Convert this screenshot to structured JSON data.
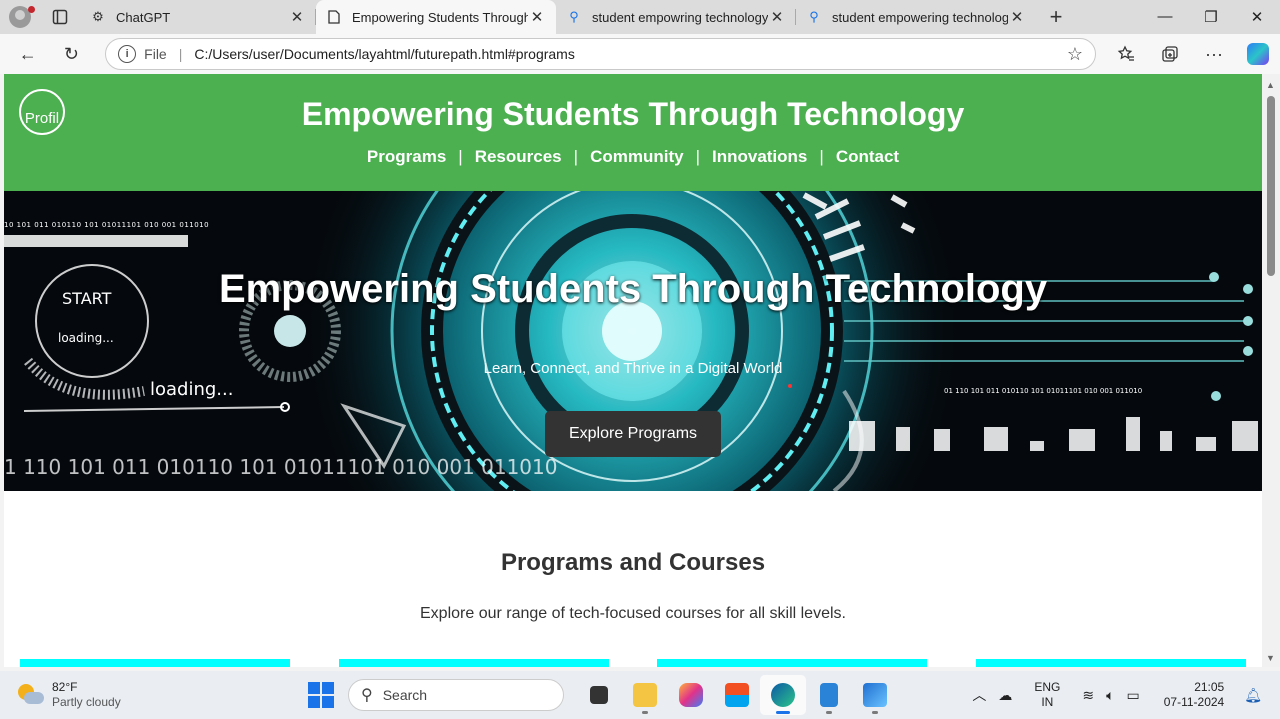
{
  "browser": {
    "tabs": [
      {
        "title": "ChatGPT",
        "icon": "chatgpt-icon",
        "active": false
      },
      {
        "title": "Empowering Students Through Te",
        "icon": "page-icon",
        "active": true
      },
      {
        "title": "student empowring technology s",
        "icon": "search-icon",
        "active": false
      },
      {
        "title": "student empowering technology te",
        "icon": "search-icon",
        "active": false
      }
    ],
    "file_label": "File",
    "url": "C:/Users/user/Documents/layahtml/futurepath.html#programs"
  },
  "site": {
    "logo_alt": "Profil",
    "title": "Empowering Students Through Technology",
    "nav": [
      "Programs",
      "Resources",
      "Community",
      "Innovations",
      "Contact"
    ],
    "hero": {
      "title": "Empowering Students Through Technology",
      "subtitle": "Learn, Connect, and Thrive in a Digital World",
      "button": "Explore Programs",
      "deco_binary": "10 101 011 010110 101 01011101 010 001 011010",
      "deco_start": "START",
      "deco_loading_small": "loading...",
      "deco_loading": "loading...",
      "deco_binary_large": "1 110 101 011 010110 101 01011101 010 001 011010",
      "deco_binary_right": "01 110 101 011 010110 101 01011101 010 001 011010"
    },
    "programs": {
      "heading": "Programs and Courses",
      "description": "Explore our range of tech-focused courses for all skill levels."
    }
  },
  "taskbar": {
    "weather_temp": "82°F",
    "weather_desc": "Partly cloudy",
    "search_placeholder": "Search",
    "lang_1": "ENG",
    "lang_2": "IN",
    "time": "21:05",
    "date": "07-11-2024"
  },
  "colors": {
    "header_green": "#4caf50",
    "card_cyan": "#00ffff",
    "hero_glow": "#29e6ee"
  }
}
